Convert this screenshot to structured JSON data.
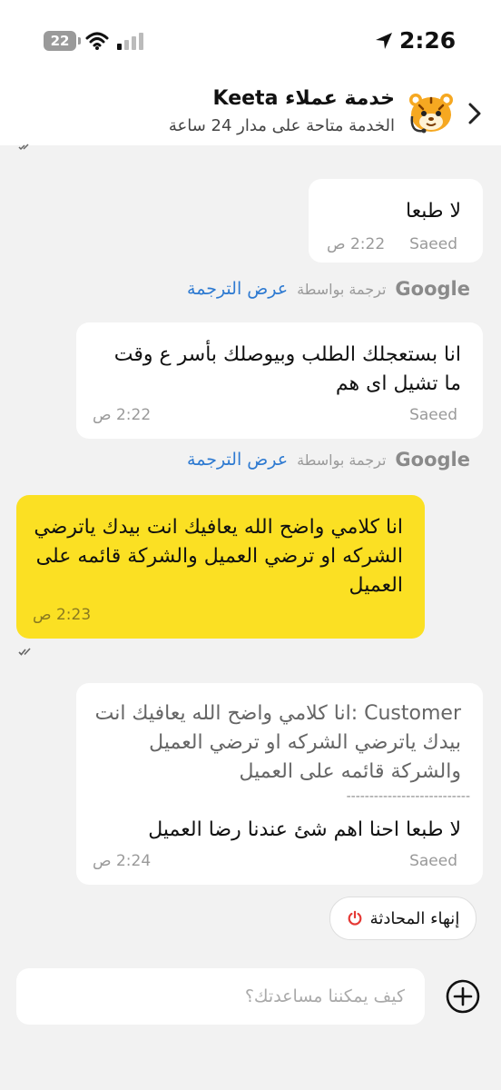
{
  "status_bar": {
    "battery": "22",
    "time": "2:26"
  },
  "header": {
    "title": "خدمة عملاء Keeta",
    "subtitle": "الخدمة متاحة على مدار 24 ساعة"
  },
  "messages": [
    {
      "sender": "Saeed",
      "text": "لا طبعا",
      "time": "2:22 ص"
    },
    {
      "sender": "Saeed",
      "text": "انا بستعجلك الطلب وبيوصلك بأسر ع  وقت ما تشيل اى  هم",
      "time": "2:22 ص"
    },
    {
      "text": "انا كلامي واضح الله يعافيك انت بيدك ياترضي الشركه او ترضي العميل والشركة قائمه على العميل",
      "time": "2:23 ص"
    },
    {
      "sender": "Saeed",
      "quote": "Customer  :انا كلامي واضح الله يعافيك انت بيدك ياترضي الشركه او ترضي العميل والشركة قائمه على العميل",
      "separator": "---------------------------",
      "text": "لا طبعا احنا اهم شئ عندنا رضا العميل",
      "time": "2:24 ص"
    }
  ],
  "translation": {
    "link": "عرض الترجمة",
    "by": "ترجمة بواسطة",
    "provider": "Google"
  },
  "end_chat": {
    "label": "إنهاء المحادثة"
  },
  "composer": {
    "placeholder": "كيف يمكننا مساعدتك؟",
    "value": ""
  },
  "colors": {
    "own_bubble": "#fbe023",
    "link": "#2e7ad1",
    "end_icon": "#e53935"
  },
  "icons": [
    "battery-icon",
    "wifi-icon",
    "signal-icon",
    "location-arrow-icon",
    "back-chevron-icon",
    "keeta-logo-icon",
    "double-check-icon",
    "power-icon",
    "plus-circle-icon"
  ]
}
